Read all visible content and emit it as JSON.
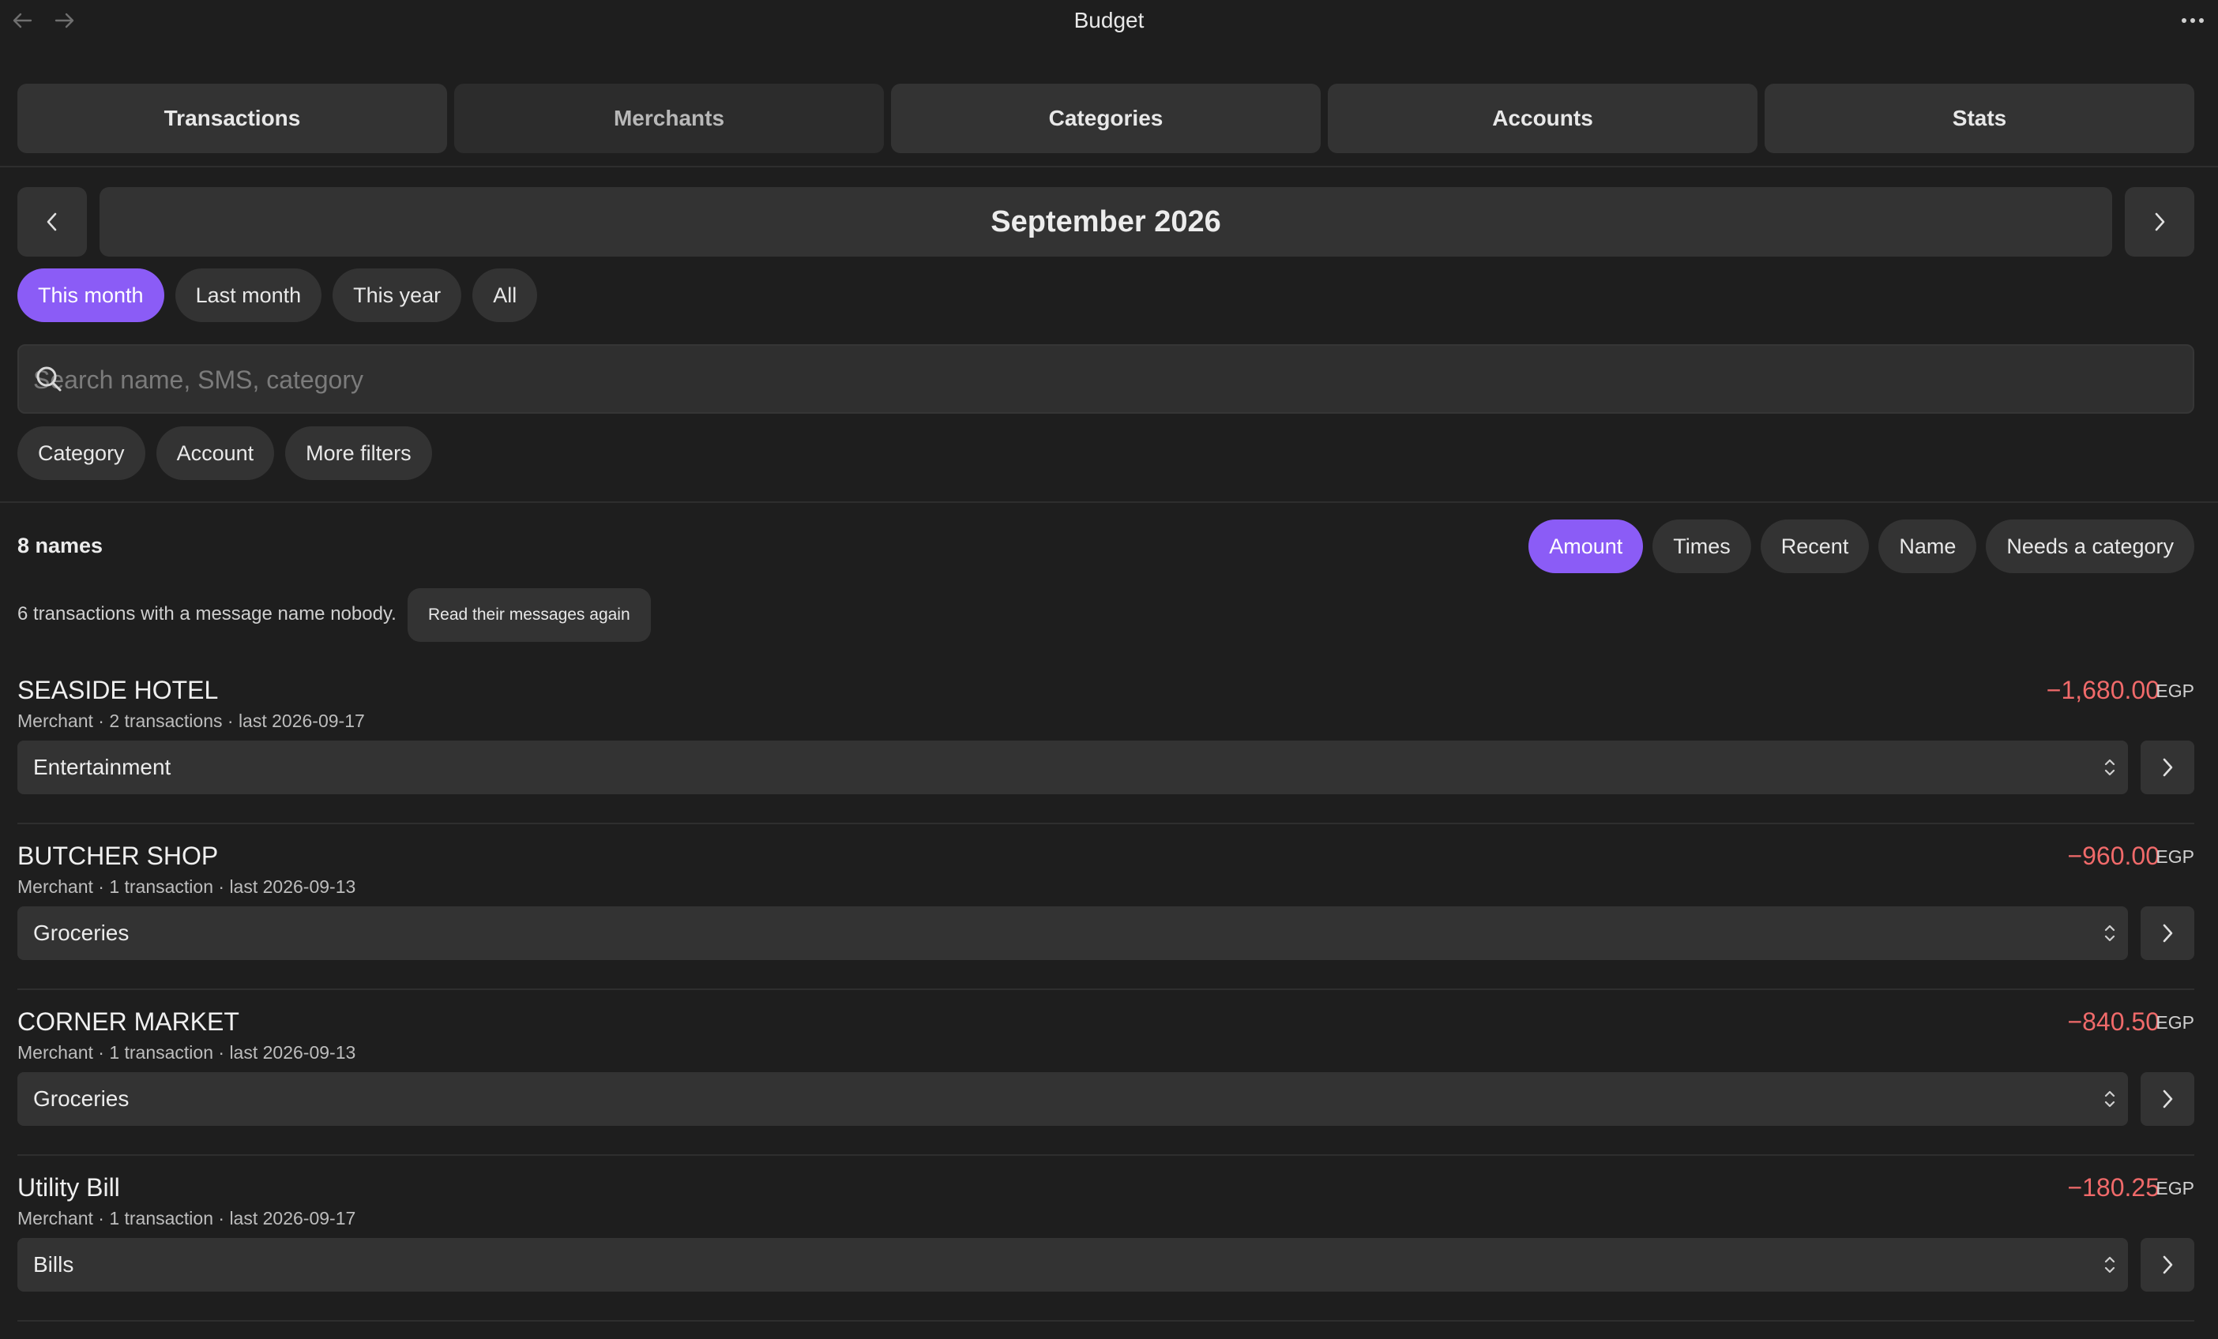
{
  "window": {
    "title": "Budget",
    "back_icon": "arrow-left-icon",
    "forward_icon": "arrow-right-icon",
    "more_icon": "more-horizontal-icon"
  },
  "tabs": [
    {
      "label": "Transactions"
    },
    {
      "label": "Merchants"
    },
    {
      "label": "Categories"
    },
    {
      "label": "Accounts"
    },
    {
      "label": "Stats"
    }
  ],
  "period": {
    "label": "September 2026",
    "ranges": [
      "This month",
      "Last month",
      "This year",
      "All"
    ],
    "selected_range": "This month"
  },
  "search": {
    "placeholder": "Search name, SMS, category",
    "value": ""
  },
  "filters": [
    "Category",
    "Account",
    "More filters"
  ],
  "list": {
    "count_label": "8 names",
    "sort_options": [
      "Amount",
      "Times",
      "Recent",
      "Name",
      "Needs a category"
    ],
    "selected_sort": "Amount",
    "notice": "6 transactions with a message name nobody.",
    "reread_label": "Read their messages again",
    "items": [
      {
        "name": "SEASIDE HOTEL",
        "meta": "Merchant · 2 transactions · last 2026-09-17",
        "amount": "−1,680.00",
        "currency": "EGP",
        "category": "Entertainment"
      },
      {
        "name": "BUTCHER SHOP",
        "meta": "Merchant · 1 transaction · last 2026-09-13",
        "amount": "−960.00",
        "currency": "EGP",
        "category": "Groceries"
      },
      {
        "name": "CORNER MARKET",
        "meta": "Merchant · 1 transaction · last 2026-09-13",
        "amount": "−840.50",
        "currency": "EGP",
        "category": "Groceries"
      },
      {
        "name": "Utility Bill",
        "meta": "Merchant · 1 transaction · last 2026-09-17",
        "amount": "−180.25",
        "currency": "EGP",
        "category": "Bills"
      }
    ]
  },
  "colors": {
    "background": "#1e1e1e",
    "surface": "#333333",
    "accent": "#8b5cf6",
    "negative_amount": "#f06a6a"
  }
}
